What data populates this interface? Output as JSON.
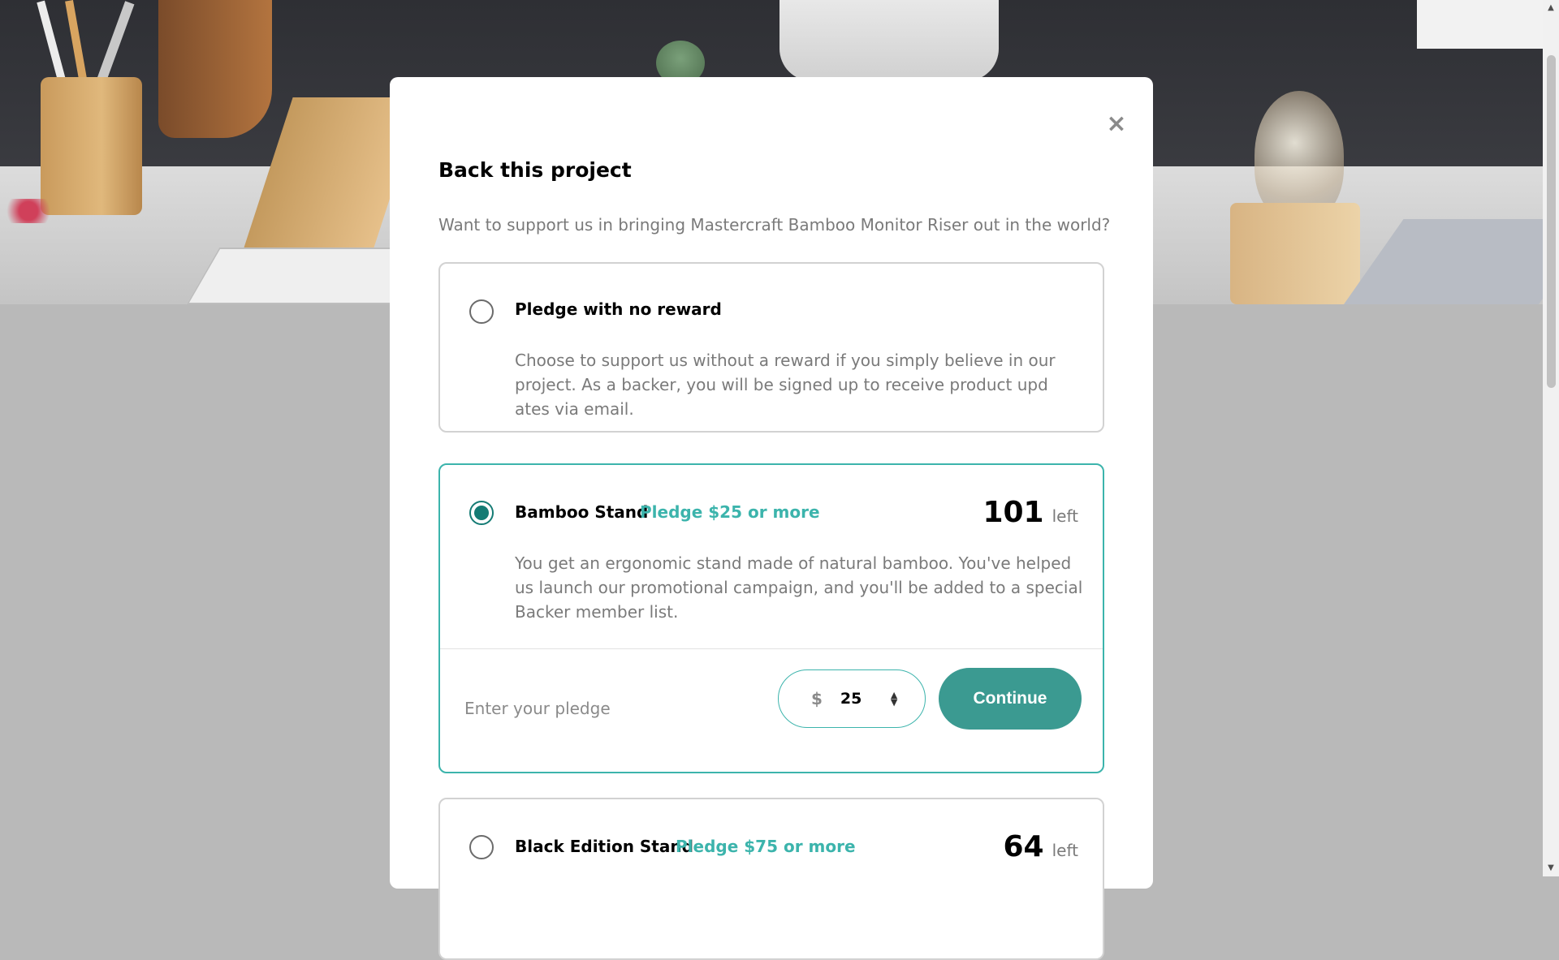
{
  "modal": {
    "close_icon": "×",
    "title": "Back this project",
    "subtitle": "Want to support us in bringing Mastercraft Bamboo Monitor Riser out in the world?"
  },
  "options": [
    {
      "name": "Pledge with no reward",
      "description": "Choose to support us without a reward if you simply believe in our project. As a backer, you will be signed up to receive product upd ates via email.",
      "selected": false
    },
    {
      "name": "Bamboo Stand",
      "pledge": "Pledge $25 or more",
      "left_count": "101",
      "left_label": "left",
      "description": "You get an ergonomic stand made of natural bamboo. You've helped us launch our promotional campaign, and you'll be added to a special Backer member list.",
      "selected": true,
      "enter_label": "Enter your pledge",
      "currency": "$",
      "amount": "25",
      "continue_label": "Continue"
    },
    {
      "name": "Black Edition Stand",
      "pledge": "Pledge $75 or more",
      "left_count": "64",
      "left_label": "left",
      "selected": false
    }
  ],
  "colors": {
    "accent": "#3cb4ac",
    "accent_dark": "#147b74",
    "button": "#3b9a91"
  },
  "icons": {
    "close": "close-icon",
    "scroll_up": "arrow-up-icon",
    "scroll_down": "arrow-down-icon",
    "spinner": "stepper-arrows-icon"
  }
}
